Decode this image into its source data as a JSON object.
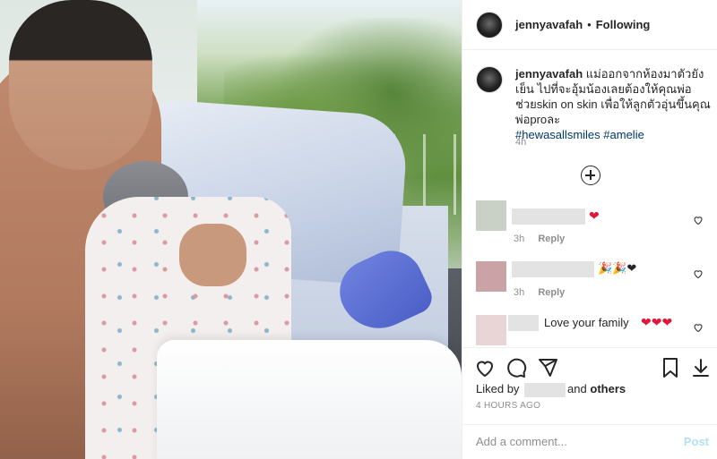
{
  "header": {
    "username": "jennyavafah",
    "separator": "•",
    "follow_status": "Following"
  },
  "caption": {
    "username": "jennyavafah",
    "text": "แม่ออกจากห้องมาตัวยังเย็น ไปที่จะอุ้มน้องเลยต้องให้คุณพ่อช่วยskin on skin เพื่อให้ลูกตัวอุ่นขึ้นคุณพ่อproละ",
    "hashtags": [
      "#hewasallsmiles",
      "#amelie"
    ],
    "time": "4h"
  },
  "comments": [
    {
      "emoji": "❤",
      "time": "3h",
      "reply_label": "Reply",
      "avatar_color": "#c9d0c6"
    },
    {
      "emoji": "🎉🎉❤",
      "time": "3h",
      "reply_label": "Reply",
      "avatar_color": "#c9a3a6"
    },
    {
      "text": "Love your family",
      "emoji": "❤❤❤",
      "avatar_color": "#e9d5d5"
    }
  ],
  "footer": {
    "liked_prefix": "Liked by",
    "liked_mid": "and",
    "liked_others": "others",
    "timestamp": "4 HOURS AGO",
    "add_comment_placeholder": "Add a comment...",
    "post_label": "Post"
  },
  "icons": [
    "heart-icon",
    "comment-icon",
    "share-icon",
    "bookmark-icon",
    "download-icon",
    "load-more-icon"
  ]
}
